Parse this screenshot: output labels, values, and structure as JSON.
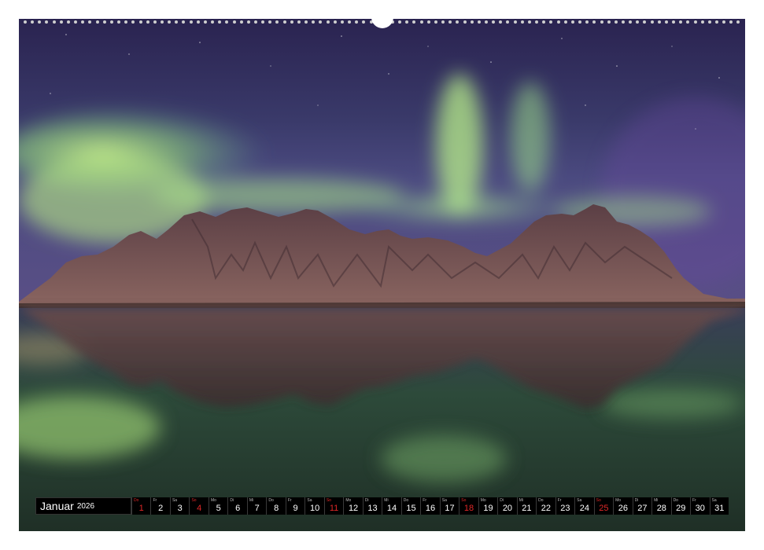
{
  "calendar": {
    "month": "Januar",
    "year": "2026",
    "days": [
      {
        "wd": "Do",
        "n": "1",
        "sun": true
      },
      {
        "wd": "Fr",
        "n": "2",
        "sun": false
      },
      {
        "wd": "Sa",
        "n": "3",
        "sun": false
      },
      {
        "wd": "So",
        "n": "4",
        "sun": true
      },
      {
        "wd": "Mo",
        "n": "5",
        "sun": false
      },
      {
        "wd": "Di",
        "n": "6",
        "sun": false
      },
      {
        "wd": "Mi",
        "n": "7",
        "sun": false
      },
      {
        "wd": "Do",
        "n": "8",
        "sun": false
      },
      {
        "wd": "Fr",
        "n": "9",
        "sun": false
      },
      {
        "wd": "Sa",
        "n": "10",
        "sun": false
      },
      {
        "wd": "So",
        "n": "11",
        "sun": true
      },
      {
        "wd": "Mo",
        "n": "12",
        "sun": false
      },
      {
        "wd": "Di",
        "n": "13",
        "sun": false
      },
      {
        "wd": "Mi",
        "n": "14",
        "sun": false
      },
      {
        "wd": "Do",
        "n": "15",
        "sun": false
      },
      {
        "wd": "Fr",
        "n": "16",
        "sun": false
      },
      {
        "wd": "Sa",
        "n": "17",
        "sun": false
      },
      {
        "wd": "So",
        "n": "18",
        "sun": true
      },
      {
        "wd": "Mo",
        "n": "19",
        "sun": false
      },
      {
        "wd": "Di",
        "n": "20",
        "sun": false
      },
      {
        "wd": "Mi",
        "n": "21",
        "sun": false
      },
      {
        "wd": "Do",
        "n": "22",
        "sun": false
      },
      {
        "wd": "Fr",
        "n": "23",
        "sun": false
      },
      {
        "wd": "Sa",
        "n": "24",
        "sun": false
      },
      {
        "wd": "So",
        "n": "25",
        "sun": true
      },
      {
        "wd": "Mo",
        "n": "26",
        "sun": false
      },
      {
        "wd": "Di",
        "n": "27",
        "sun": false
      },
      {
        "wd": "Mi",
        "n": "28",
        "sun": false
      },
      {
        "wd": "Do",
        "n": "29",
        "sun": false
      },
      {
        "wd": "Fr",
        "n": "30",
        "sun": false
      },
      {
        "wd": "Sa",
        "n": "31",
        "sun": false
      }
    ]
  },
  "colors": {
    "sky_top": "#2a2350",
    "aurora": "#9be07a",
    "mountain": "#6a4a4e",
    "sunday_red": "#e02828",
    "bar_bg": "#000000"
  }
}
